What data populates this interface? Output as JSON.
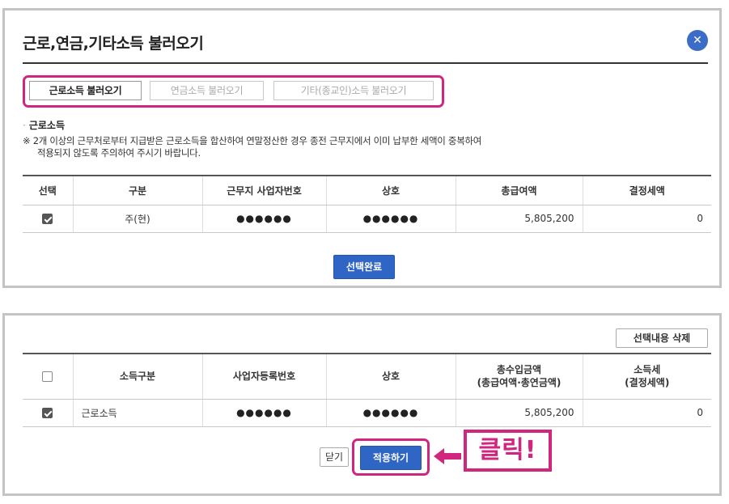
{
  "panel1": {
    "title": "근로,연금,기타소득 불러오기",
    "close_icon": "close-icon",
    "tabs": [
      {
        "label": "근로소득 불러오기",
        "active": true
      },
      {
        "label": "연금소득 불러오기",
        "active": false
      },
      {
        "label": "기타(종교인)소득 불러오기",
        "active": false
      }
    ],
    "section_label": "근로소득",
    "notice_line1": "※ 2개 이상의 근무처로부터 지급받은 근로소득을 합산하여 연말정산한 경우 종전 근무지에서 이미 납부한 세액이 중복하여",
    "notice_line2": "적용되지 않도록 주의하여 주시기 바랍니다.",
    "table": {
      "headers": [
        "선택",
        "구분",
        "근무지 사업자번호",
        "상호",
        "총급여액",
        "결정세액"
      ],
      "rows": [
        {
          "checked": true,
          "type": "주(현)",
          "biz_no": "●●●●●●",
          "name": "●●●●●●",
          "total_pay": "5,805,200",
          "tax": "0"
        }
      ]
    },
    "confirm_button": "선택완료"
  },
  "panel2": {
    "delete_button": "선택내용 삭제",
    "table": {
      "headers": [
        {
          "line1": "",
          "line2": ""
        },
        {
          "line1": "소득구분",
          "line2": ""
        },
        {
          "line1": "사업자등록번호",
          "line2": ""
        },
        {
          "line1": "상호",
          "line2": ""
        },
        {
          "line1": "총수입금액",
          "line2": "(총급여액·총연금액)"
        },
        {
          "line1": "소득세",
          "line2": "(결정세액)"
        }
      ],
      "rows": [
        {
          "checked": true,
          "income_type": "근로소득",
          "biz_no": "●●●●●●",
          "name": "●●●●●●",
          "total_income": "5,805,200",
          "tax": "0"
        }
      ]
    },
    "close_button": "닫기",
    "apply_button": "적용하기",
    "annotation": "클릭!"
  },
  "colors": {
    "accent_blue": "#2f65c4",
    "highlight_pink": "#d0267e",
    "frame_gray": "#c4c4c4"
  }
}
